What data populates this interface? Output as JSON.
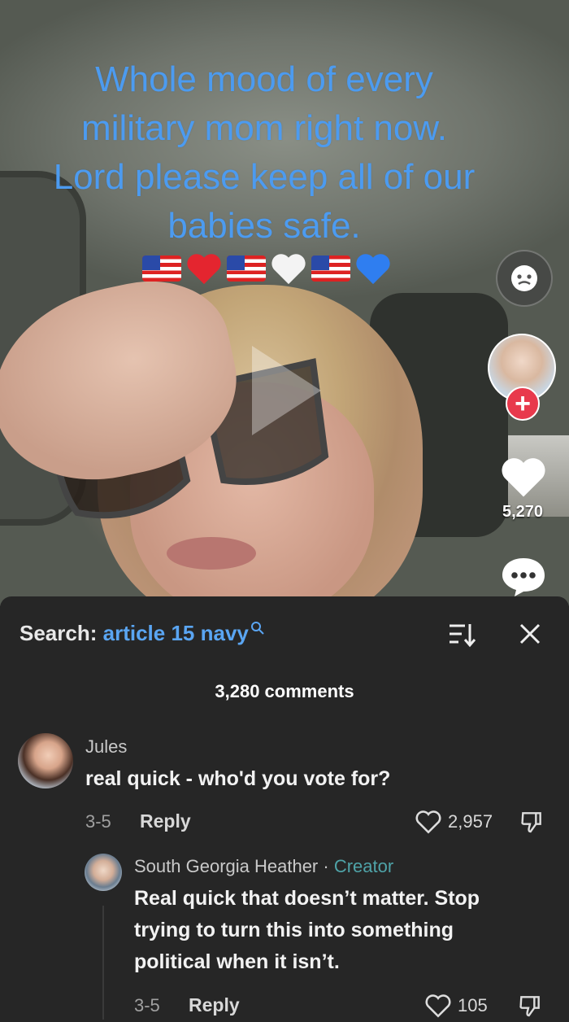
{
  "video": {
    "caption_lines": [
      "Whole mood of every",
      "military mom right now.",
      "Lord please keep all of our",
      "babies safe."
    ],
    "emojis": [
      "us-flag",
      "red-heart",
      "us-flag",
      "white-heart",
      "us-flag",
      "blue-heart"
    ],
    "like_count": "5,270"
  },
  "comments_panel": {
    "search_label": "Search:",
    "search_term": "article 15 navy",
    "comment_count": "3,280 comments",
    "comments": [
      {
        "username": "Jules",
        "text": "real quick - who'd you vote for?",
        "date": "3-5",
        "reply_label": "Reply",
        "likes": "2,957"
      }
    ],
    "replies": [
      {
        "username": "South Georgia Heather",
        "separator": " · ",
        "badge": "Creator",
        "text_lines": [
          "Real quick that doesn’t matter. Stop",
          "trying to turn this into something",
          "political when it isn’t."
        ],
        "date": "3-5",
        "reply_label": "Reply",
        "likes": "105"
      }
    ]
  },
  "colors": {
    "caption_blue": "#4c9bf0",
    "search_blue": "#5aa5f2",
    "creator_teal": "#4fa3a8",
    "follow_red": "#e8394c",
    "sheet_bg": "#262626"
  },
  "icons": [
    "face-filter-icon",
    "follow-plus-icon",
    "heart-icon",
    "comment-icon",
    "search-icon",
    "sort-icon",
    "close-icon",
    "dislike-icon"
  ]
}
